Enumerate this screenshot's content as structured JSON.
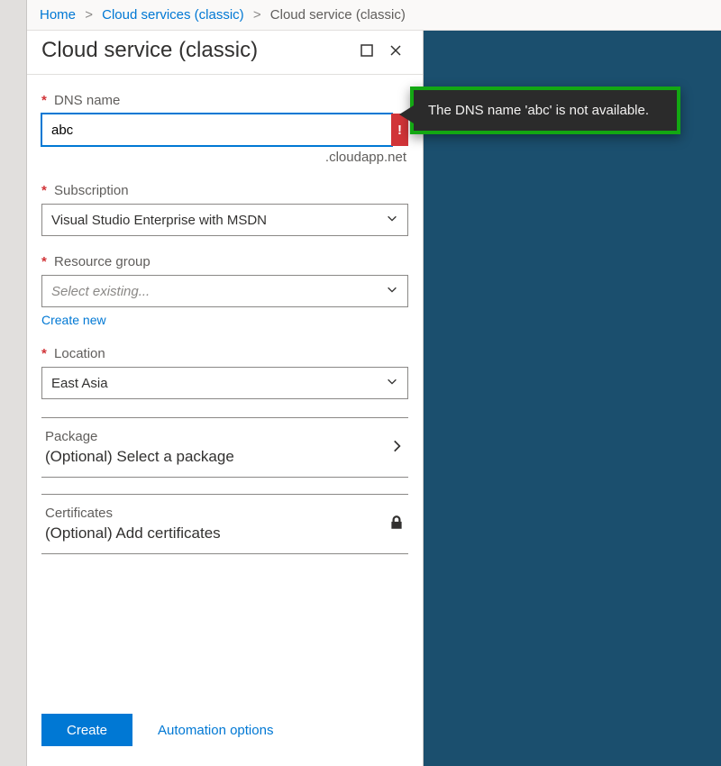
{
  "breadcrumb": {
    "home": "Home",
    "one": "Cloud services (classic)",
    "two": "Cloud service (classic)"
  },
  "blade": {
    "title": "Cloud service (classic)"
  },
  "tooltip": {
    "text": "The DNS name 'abc' is not available."
  },
  "form": {
    "dns": {
      "label": "DNS name",
      "value": "abc",
      "suffix": ".cloudapp.net",
      "error_glyph": "!"
    },
    "subscription": {
      "label": "Subscription",
      "value": "Visual Studio Enterprise with MSDN"
    },
    "resourceGroup": {
      "label": "Resource group",
      "placeholder": "Select existing...",
      "createNew": "Create new"
    },
    "location": {
      "label": "Location",
      "value": "East Asia"
    },
    "package": {
      "title": "Package",
      "sub": "(Optional) Select a package"
    },
    "certificates": {
      "title": "Certificates",
      "sub": "(Optional) Add certificates"
    }
  },
  "footer": {
    "create": "Create",
    "automation": "Automation options"
  }
}
